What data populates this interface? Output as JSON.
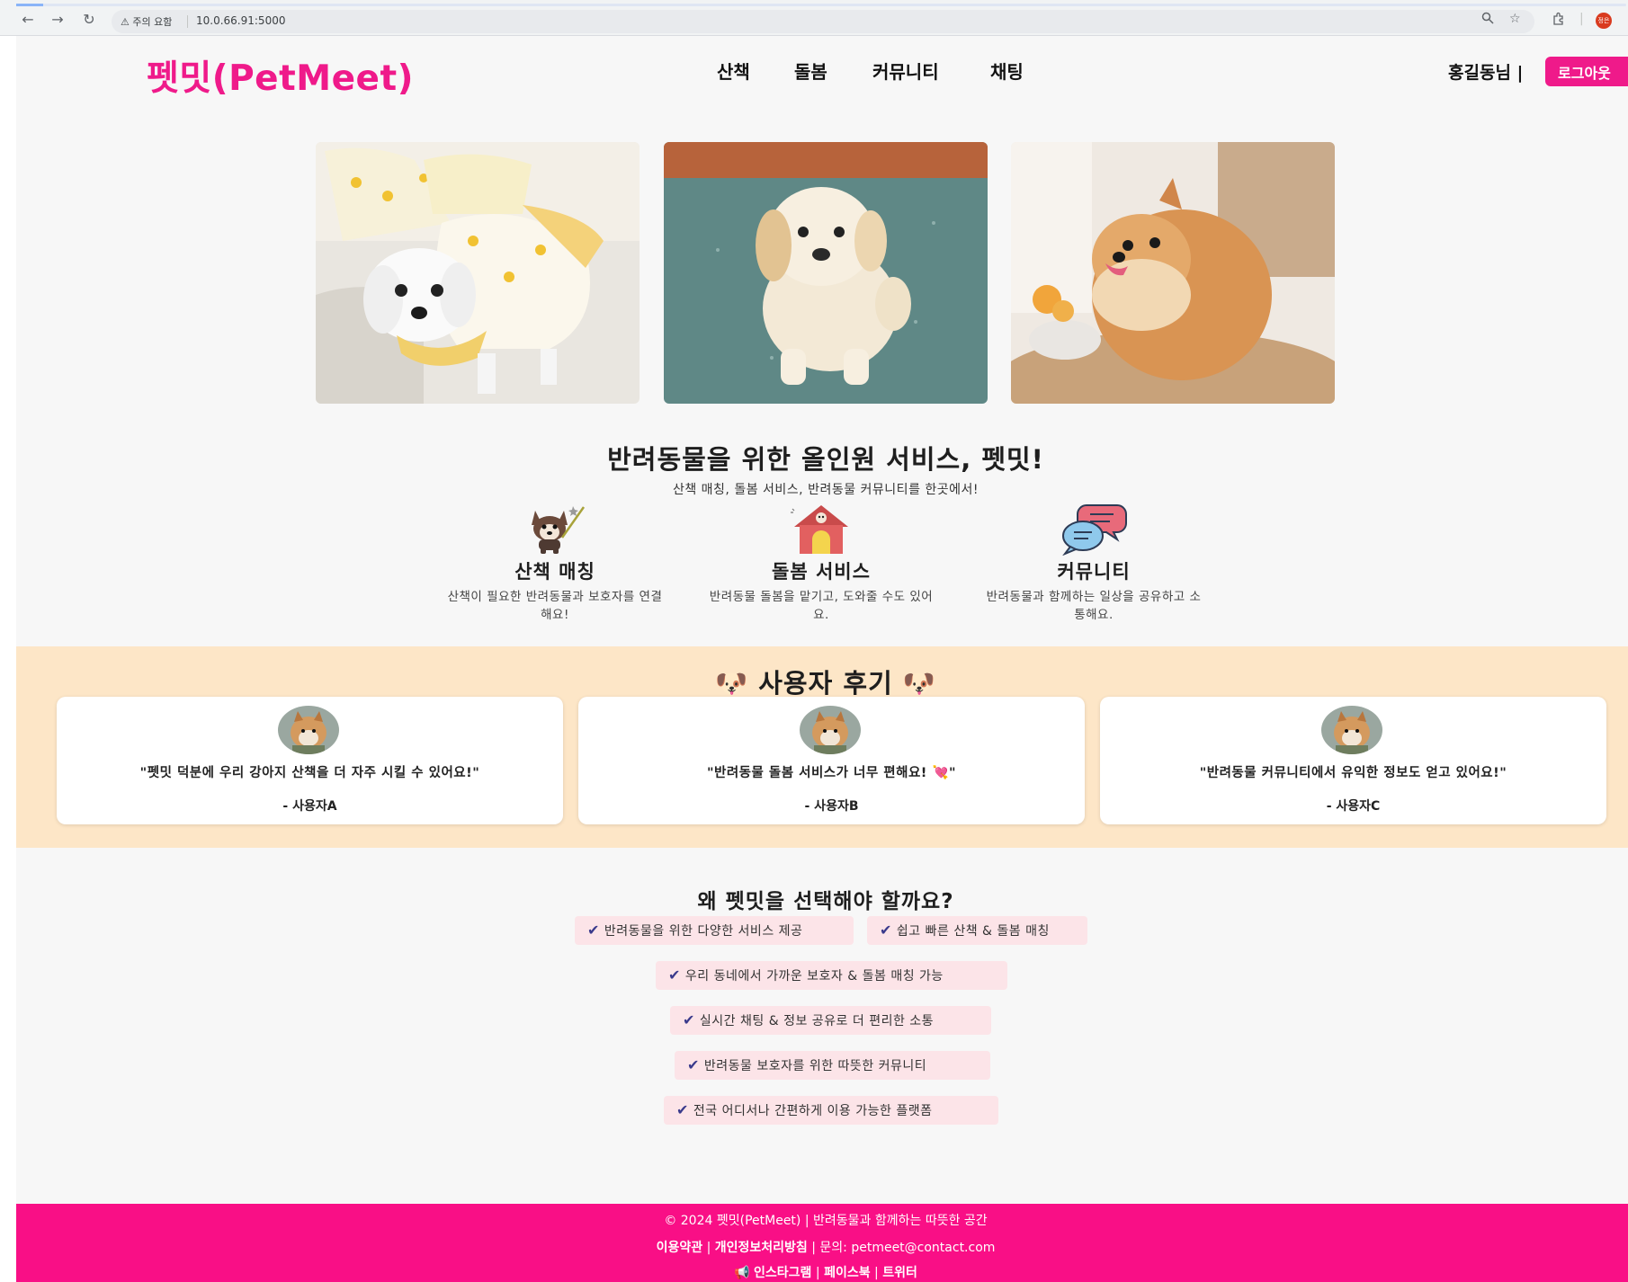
{
  "browser": {
    "security_label": "주의 요함",
    "url": "10.0.66.91:5000",
    "profile_initials": "정은"
  },
  "header": {
    "logo": "펫밋(PetMeet)",
    "nav": [
      "산책",
      "돌봄",
      "커뮤니티",
      "채팅"
    ],
    "user_greeting": "홍길동님 |",
    "logout_label": "로그아웃"
  },
  "hero_images": [
    "maltese-in-yellow-dress",
    "golden-retriever-puppy",
    "pomeranian-on-table"
  ],
  "intro": {
    "headline": "반려동물을 위한 올인원 서비스, 펫밋!",
    "subline": "산책 매칭, 돌봄 서비스, 반려동물 커뮤니티를 한곳에서!"
  },
  "features": [
    {
      "icon": "dog-walking-icon",
      "title": "산책 매칭",
      "desc": "산책이 필요한 반려동물과 보호자를 연결해요!"
    },
    {
      "icon": "dog-house-icon",
      "title": "돌봄 서비스",
      "desc": "반려동물 돌봄을 맡기고, 도와줄 수도 있어요."
    },
    {
      "icon": "chat-bubbles-icon",
      "title": "커뮤니티",
      "desc": "반려동물과 함께하는 일상을 공유하고 소통해요."
    }
  ],
  "reviews": {
    "title": "🐶 사용자 후기 🐶",
    "items": [
      {
        "text": "\"펫밋 덕분에 우리 강아지 산책을 더 자주 시킬 수 있어요!\"",
        "author": "- 사용자A"
      },
      {
        "text": "\"반려동물 돌봄 서비스가 너무 편해요! 💘\"",
        "author": "- 사용자B"
      },
      {
        "text": "\"반려동물 커뮤니티에서 유익한 정보도 얻고 있어요!\"",
        "author": "- 사용자C"
      }
    ]
  },
  "why": {
    "title": "왜 펫밋을 선택해야 할까요?",
    "items": [
      "반려동물을 위한 다양한 서비스 제공",
      "쉽고 빠른 산책 & 돌봄 매칭",
      "우리 동네에서 가까운 보호자 & 돌봄 매칭 가능",
      "실시간 채팅 & 정보 공유로 더 편리한 소통",
      "반려동물 보호자를 위한 따뜻한 커뮤니티",
      "전국 어디서나 간편하게 이용 가능한 플랫폼"
    ]
  },
  "footer": {
    "copyright": "© 2024 펫밋(PetMeet) | 반려동물과 함께하는 따뜻한 공간",
    "terms": "이용약관",
    "privacy": "개인정보처리방침",
    "contact": "| 문의: petmeet@contact.com",
    "sep": "|",
    "social": [
      "인스타그램",
      "페이스북",
      "트위터"
    ]
  },
  "colors": {
    "brand_pink": "#ef1a8a",
    "footer_pink": "#f90f86",
    "review_bg": "#fde6c7",
    "why_chip_bg": "#fce4e8"
  }
}
